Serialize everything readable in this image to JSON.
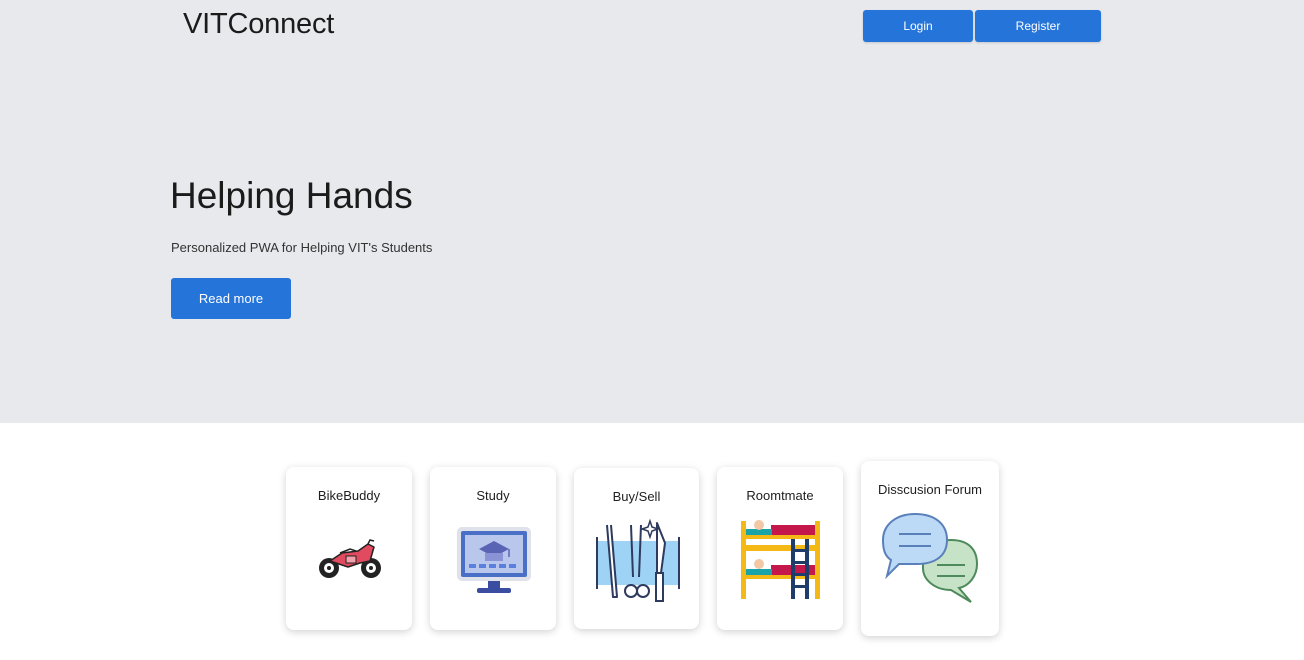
{
  "header": {
    "brand": "VITConnect",
    "login_label": "Login",
    "register_label": "Register"
  },
  "hero": {
    "title": "Helping Hands",
    "subtitle": "Personalized PWA for Helping VIT's Students",
    "cta_label": "Read more"
  },
  "services": [
    {
      "label": "BikeBuddy",
      "icon": "motorcycle-icon"
    },
    {
      "label": "Study",
      "icon": "monitor-graduation-icon"
    },
    {
      "label": "Buy/Sell",
      "icon": "tools-icon"
    },
    {
      "label": "Roomtmate",
      "icon": "bunk-bed-icon"
    },
    {
      "label": "Disscusion Forum",
      "icon": "chat-bubbles-icon"
    }
  ],
  "colors": {
    "hero_bg": "#e8e9ed",
    "accent": "#2574d9"
  }
}
